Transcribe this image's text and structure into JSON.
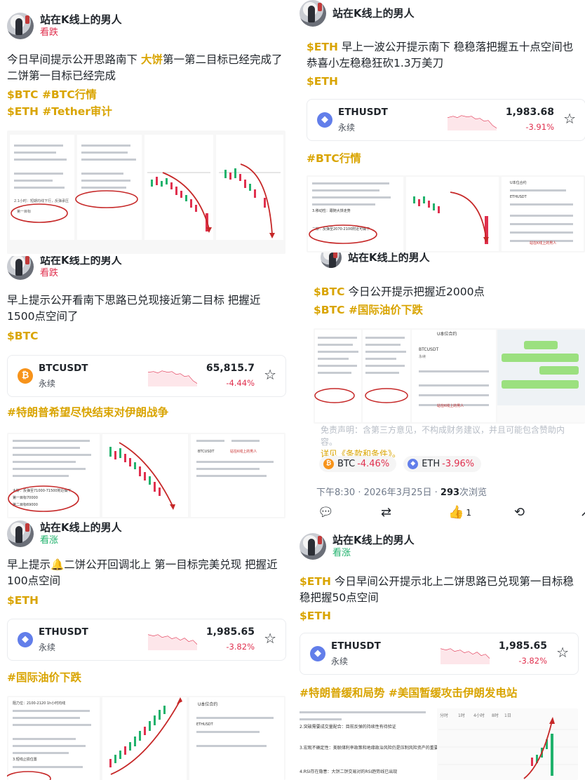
{
  "author": "站在K线上的男人",
  "watermark": "站在K线上的男人",
  "left_posts": [
    {
      "sentiment": "看跌",
      "text_pre": "今日早间提示公开思路南下 ",
      "text_hl": "大饼",
      "text_post": "第一第二目标已经完成了 二饼第一目标已经完成",
      "tags": [
        "$BTC #BTC行情",
        "$ETH #Tether审计"
      ]
    },
    {
      "sentiment": "看跌",
      "text": "早上提示公开看南下思路已兑现接近第二目标 把握近1500点空间了",
      "tags": [
        "$BTC"
      ],
      "ticker": {
        "symbol": "BTCUSDT",
        "type": "永续",
        "price": "65,815.7",
        "change": "-4.44%",
        "icon": "bitcoin-icon"
      },
      "hashtag": "#特朗普希望尽快结束对伊朗战争"
    },
    {
      "sentiment": "看涨",
      "text": "早上提示🔔二饼公开回调北上 第一目标完美兑现 把握近100点空间",
      "tags": [
        "$ETH"
      ],
      "ticker": {
        "symbol": "ETHUSDT",
        "type": "永续",
        "price": "1,985.65",
        "change": "-3.82%",
        "icon": "ethereum-icon"
      },
      "hashtag": "#国际油价下跌"
    }
  ],
  "right_posts": [
    {
      "text_tag": "$ETH",
      "text": " 早上一波公开提示南下 稳稳落把握五十点空间也恭喜小左稳稳狂砍1.3万美刀",
      "tags": [
        "$ETH"
      ],
      "ticker": {
        "symbol": "ETHUSDT",
        "type": "永续",
        "price": "1,983.68",
        "change": "-3.91%",
        "icon": "ethereum-icon"
      },
      "hashtag": "#BTC行情"
    },
    {
      "text_tag": "$BTC",
      "text": " 今日公开提示把握近2000点",
      "tags": [
        "$BTC #国际油价下跌"
      ],
      "disclaimer": "免责声明：含第三方意见，不构成财务建议，并且可能包含赞助内容。",
      "disclaimer_link": "详见《条款和条件》。",
      "chips": [
        {
          "symbol": "BTC",
          "change": "-4.46%",
          "icon": "bitcoin-icon"
        },
        {
          "symbol": "ETH",
          "change": "-3.96%",
          "icon": "ethereum-icon"
        }
      ],
      "time": "下午8:30 · 2026年3月25日 ·",
      "views": "293",
      "views_label": "次浏览",
      "like_count": "1"
    },
    {
      "sentiment": "看涨",
      "text_tag": "$ETH",
      "text": " 今日早间公开提示北上二饼思路已兑现第一目标稳稳把握50点空间",
      "tags": [
        "$ETH"
      ],
      "ticker": {
        "symbol": "ETHUSDT",
        "type": "永续",
        "price": "1,985.65",
        "change": "-3.82%",
        "icon": "ethereum-icon"
      },
      "hashtag": "#特朗普缓和局势 #美国暂缓攻击伊朗发电站"
    }
  ],
  "screenshot_texts": {
    "lp1_a": "2.1小时：短期均线下行，反弹承压",
    "lp1_b": "第一目标",
    "lp2_a": "大饼：反弹至71000-71500附近做下",
    "lp2_b": "第一目标70000",
    "lp2_c": "第二目标69000",
    "lp3_a": "阻力位：2100-2120 1h小时均线",
    "lp3_b": "3.短线止损位置",
    "rp1_a": "3.移动性：跟随大饼走势",
    "rp1_b": "二饼：反弹至2070-2100附近可做下",
    "rp2_a": "U本位合约",
    "rp2_b": "BTCUSDT",
    "rp2_c": "永续",
    "rp3_a": "2.突破需要成交量配合：目前反弹的持续性有待验证",
    "rp3_b": "3.宏观不确定性：美联储利率政策和地缘政治风险仍是压制风险资产的重要因素",
    "rp3_c": "4.RSI存在隐患：大饼二饼交易对的RSI趋势线已出现"
  }
}
